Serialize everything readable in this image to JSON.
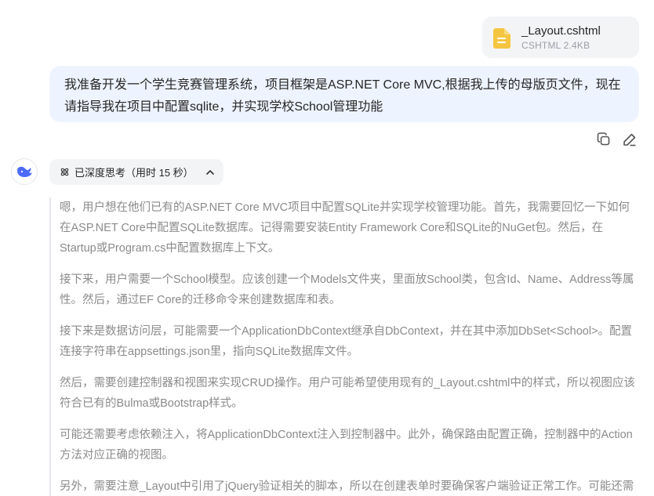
{
  "attachment": {
    "name": "_Layout.cshtml",
    "meta": "CSHTML 2.4KB",
    "icon": "document-icon",
    "icon_color": "#f5c542"
  },
  "user_message": {
    "text": "我准备开发一个学生竞赛管理系统，项目框架是ASP.NET Core MVC,根据我上传的母版页文件，现在请指导我在项目中配置sqlite，并实现学校School管理功能"
  },
  "actions": {
    "copy_icon": "copy-icon",
    "edit_icon": "edit-icon"
  },
  "assistant": {
    "avatar_icon": "whale-logo-icon",
    "brand_color": "#4d6bfe",
    "thinking": {
      "label": "已深度思考（用时 15 秒）",
      "icon": "atom-icon",
      "chevron": "chevron-up-icon"
    },
    "paragraphs": [
      "嗯，用户想在他们已有的ASP.NET Core MVC项目中配置SQLite并实现学校管理功能。首先，我需要回忆一下如何在ASP.NET Core中配置SQLite数据库。记得需要安装Entity Framework Core和SQLite的NuGet包。然后，在Startup或Program.cs中配置数据库上下文。",
      "接下来，用户需要一个School模型。应该创建一个Models文件夹，里面放School类，包含Id、Name、Address等属性。然后，通过EF Core的迁移命令来创建数据库和表。",
      "接下来是数据访问层，可能需要一个ApplicationDbContext继承自DbContext，并在其中添加DbSet<School>。配置连接字符串在appsettings.json里，指向SQLite数据库文件。",
      "然后，需要创建控制器和视图来实现CRUD操作。用户可能希望使用现有的_Layout.cshtml中的样式，所以视图应该符合已有的Bulma或Bootstrap样式。",
      "可能还需要考虑依赖注入，将ApplicationDbContext注入到控制器中。此外，确保路由配置正确，控制器中的Action方法对应正确的视图。",
      "另外，需要注意_Layout中引用了jQuery验证相关的脚本，所以在创建表单时要确保客户端验证正常工作。可能还需要"
    ]
  }
}
